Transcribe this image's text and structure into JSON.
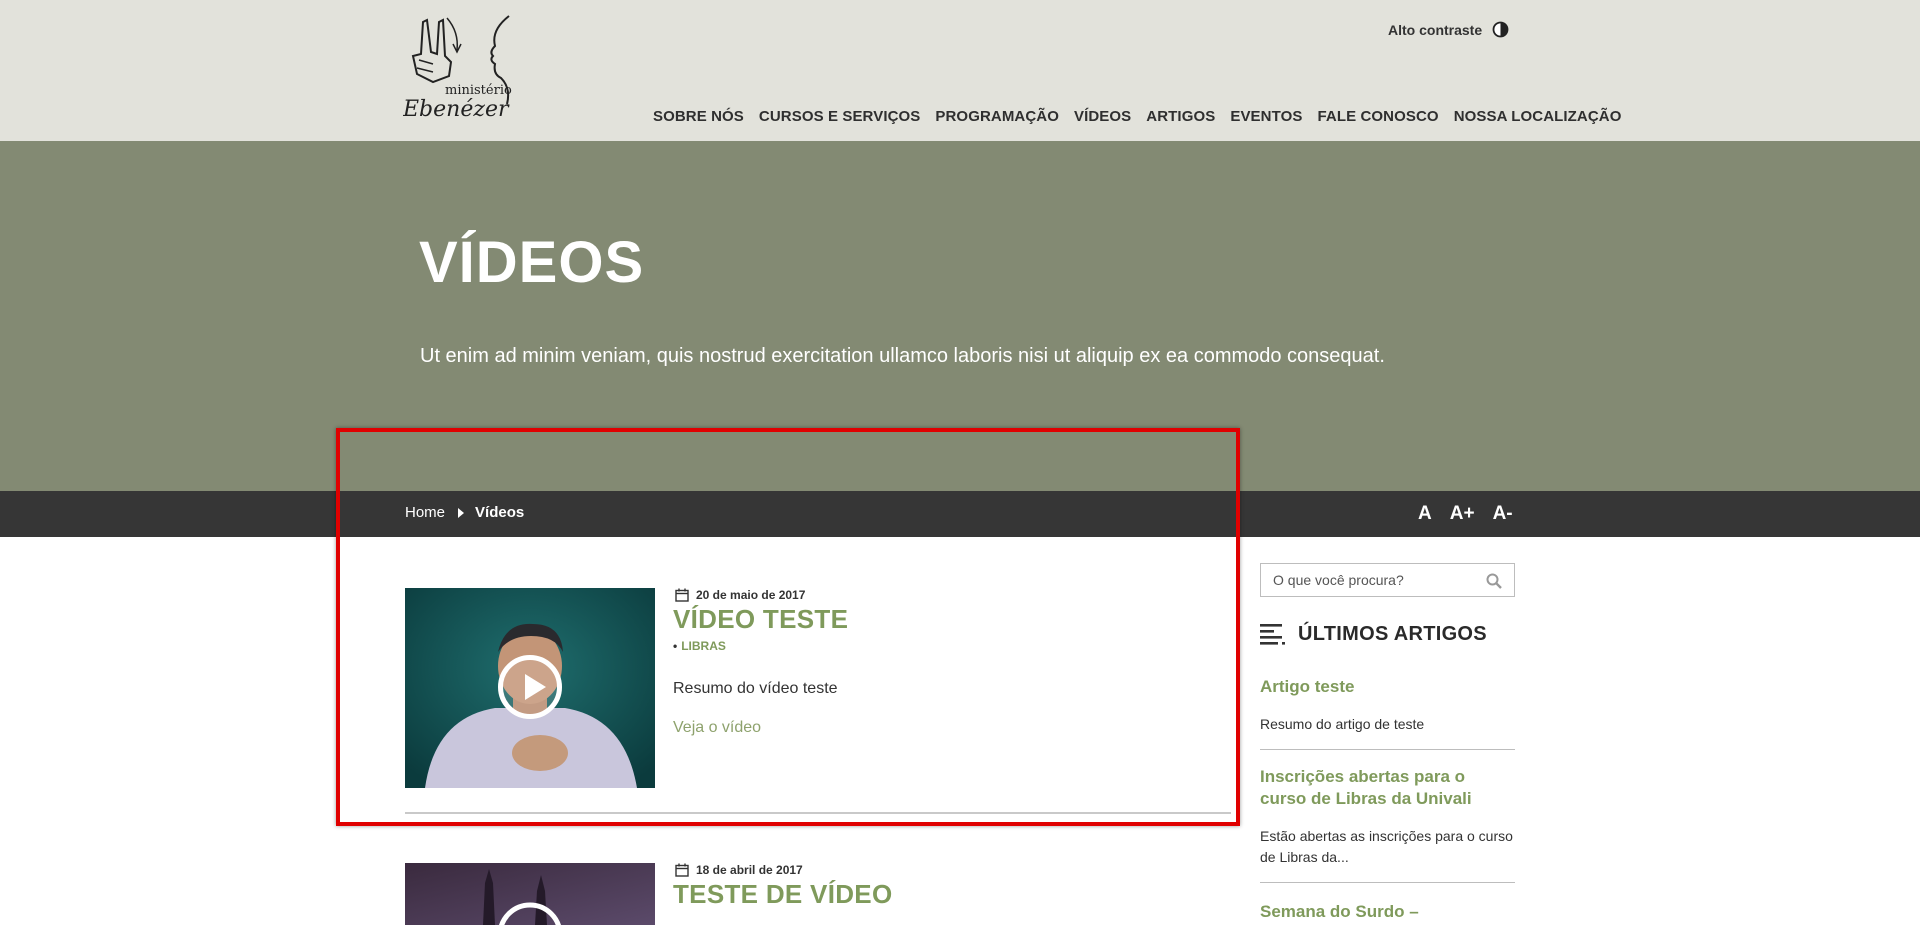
{
  "header": {
    "logo_alt": "ministério Ebenézer",
    "contrast_label": "Alto contraste",
    "nav": [
      "SOBRE NÓS",
      "CURSOS E SERVIÇOS",
      "PROGRAMAÇÃO",
      "VÍDEOS",
      "ARTIGOS",
      "EVENTOS",
      "FALE CONOSCO",
      "NOSSA LOCALIZAÇÃO"
    ]
  },
  "hero": {
    "title": "VÍDEOS",
    "subtitle": "Ut enim ad minim veniam, quis nostrud exercitation ullamco laboris nisi ut aliquip ex ea commodo consequat."
  },
  "breadcrumb": {
    "home": "Home",
    "current": "Vídeos"
  },
  "font_controls": {
    "normal": "A",
    "increase": "A+",
    "decrease": "A-"
  },
  "videos": [
    {
      "date": "20 de maio de 2017",
      "title": "VÍDEO TESTE",
      "category": "LIBRAS",
      "summary": "Resumo do vídeo teste",
      "link": "Veja o vídeo"
    },
    {
      "date": "18 de abril de 2017",
      "title": "TESTE DE VÍDEO"
    }
  ],
  "sidebar": {
    "search_placeholder": "O que você procura?",
    "heading": "ÚLTIMOS ARTIGOS",
    "articles": [
      {
        "title": "Artigo teste",
        "excerpt": "Resumo do artigo de teste"
      },
      {
        "title": "Inscrições abertas para o curso de Libras da Univali",
        "excerpt": "Estão abertas as inscrições para o curso de Libras da..."
      },
      {
        "title": "Semana do Surdo – Crispiniano"
      }
    ]
  },
  "colors": {
    "header_bg": "#e2e2db",
    "hero_bg": "#838a73",
    "crumb_bg": "#363636",
    "accent": "#7f9a5b",
    "highlight": "#e00000"
  }
}
